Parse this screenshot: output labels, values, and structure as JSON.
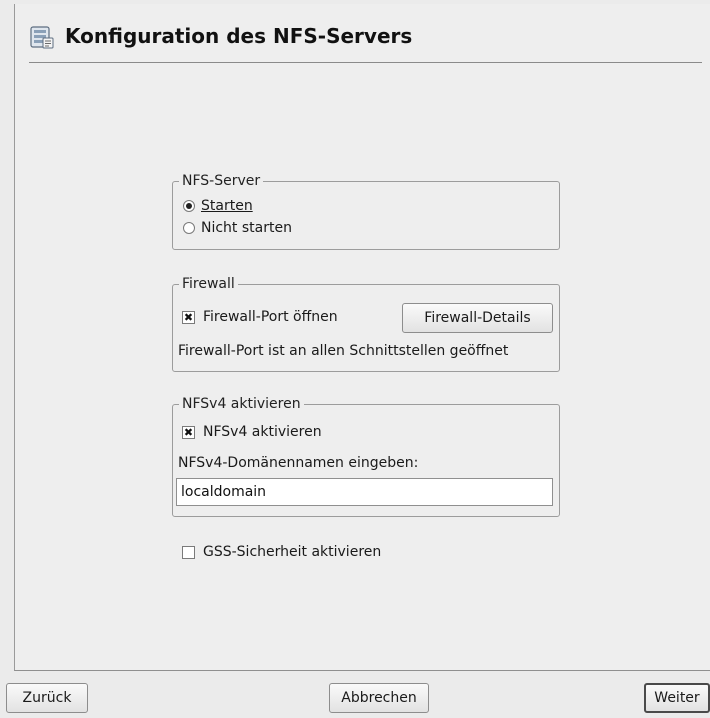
{
  "header": {
    "title": "Konfiguration des NFS-Servers",
    "icon": "server-config-icon"
  },
  "nfs_server": {
    "legend": "NFS-Server",
    "options": [
      {
        "label": "Starten",
        "selected": true
      },
      {
        "label": "Nicht starten",
        "selected": false
      }
    ]
  },
  "firewall": {
    "legend": "Firewall",
    "open_port_label": "Firewall-Port öffnen",
    "open_port_checked": true,
    "details_button": "Firewall-Details",
    "status_text": "Firewall-Port ist an allen Schnittstellen geöffnet"
  },
  "nfsv4": {
    "legend": "NFSv4 aktivieren",
    "enable_label": "NFSv4 aktivieren",
    "enable_checked": true,
    "domain_label": "NFSv4-Domänennamen eingeben:",
    "domain_value": "localdomain"
  },
  "gss": {
    "label": "GSS-Sicherheit aktivieren",
    "checked": false
  },
  "footer": {
    "back": "Zurück",
    "cancel": "Abbrechen",
    "next": "Weiter"
  }
}
